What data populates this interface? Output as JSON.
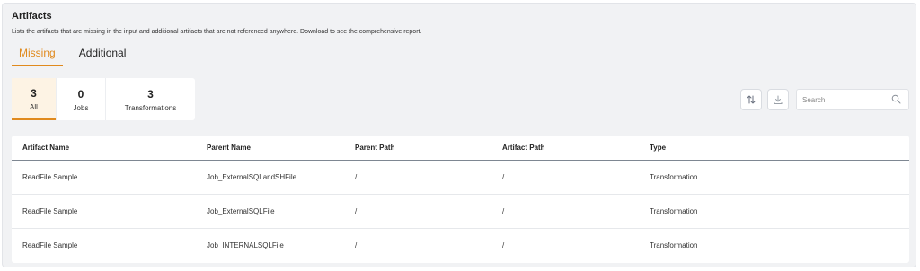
{
  "header": {
    "title": "Artifacts",
    "description": "Lists the artifacts that are missing in the input and additional artifacts that are not referenced anywhere. Download to see the comprehensive report."
  },
  "tabs": [
    {
      "label": "Missing",
      "active": true
    },
    {
      "label": "Additional",
      "active": false
    }
  ],
  "filters": [
    {
      "count": "3",
      "label": "All",
      "active": true
    },
    {
      "count": "0",
      "label": "Jobs",
      "active": false
    },
    {
      "count": "3",
      "label": "Transformations",
      "active": false
    }
  ],
  "toolbar": {
    "sort_icon": "sort-arrows-icon",
    "download_icon": "download-icon",
    "search_placeholder": "Search",
    "search_icon": "search-icon"
  },
  "table": {
    "columns": [
      "Artifact Name",
      "Parent Name",
      "Parent Path",
      "Artifact Path",
      "Type"
    ],
    "rows": [
      [
        "ReadFile Sample",
        "Job_ExternalSQLandSHFile",
        "/",
        "/",
        "Transformation"
      ],
      [
        "ReadFile Sample",
        "Job_ExternalSQLFile",
        "/",
        "/",
        "Transformation"
      ],
      [
        "ReadFile Sample",
        "Job_INTERNALSQLFile",
        "/",
        "/",
        "Transformation"
      ]
    ]
  },
  "colors": {
    "accent": "#e08a1e",
    "panel_background": "#f1f2f4",
    "active_filter_background": "#fdf3e4"
  }
}
